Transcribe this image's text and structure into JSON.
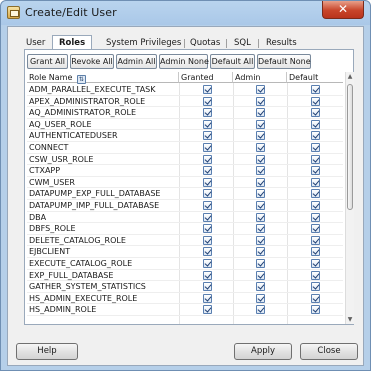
{
  "window": {
    "title": "Create/Edit User",
    "close_glyph": "✕"
  },
  "tabs": [
    {
      "label": "User"
    },
    {
      "label": "Roles",
      "active": true
    },
    {
      "label": "System Privileges"
    },
    {
      "label": "Quotas"
    },
    {
      "label": "SQL"
    },
    {
      "label": "Results"
    }
  ],
  "toolbar": [
    "Grant All",
    "Revoke All",
    "Admin All",
    "Admin None",
    "Default All",
    "Default None"
  ],
  "grid": {
    "columns": [
      "Role Name",
      "Granted",
      "Admin",
      "Default"
    ],
    "sort_icon": "sort-icon",
    "rows": [
      {
        "name": "ADM_PARALLEL_EXECUTE_TASK",
        "granted": true,
        "admin": true,
        "default": true
      },
      {
        "name": "APEX_ADMINISTRATOR_ROLE",
        "granted": true,
        "admin": true,
        "default": true
      },
      {
        "name": "AQ_ADMINISTRATOR_ROLE",
        "granted": true,
        "admin": true,
        "default": true
      },
      {
        "name": "AQ_USER_ROLE",
        "granted": true,
        "admin": true,
        "default": true
      },
      {
        "name": "AUTHENTICATEDUSER",
        "granted": true,
        "admin": true,
        "default": true
      },
      {
        "name": "CONNECT",
        "granted": true,
        "admin": true,
        "default": true
      },
      {
        "name": "CSW_USR_ROLE",
        "granted": true,
        "admin": true,
        "default": true
      },
      {
        "name": "CTXAPP",
        "granted": true,
        "admin": true,
        "default": true
      },
      {
        "name": "CWM_USER",
        "granted": true,
        "admin": true,
        "default": true
      },
      {
        "name": "DATAPUMP_EXP_FULL_DATABASE",
        "granted": true,
        "admin": true,
        "default": true
      },
      {
        "name": "DATAPUMP_IMP_FULL_DATABASE",
        "granted": true,
        "admin": true,
        "default": true
      },
      {
        "name": "DBA",
        "granted": true,
        "admin": true,
        "default": true
      },
      {
        "name": "DBFS_ROLE",
        "granted": true,
        "admin": true,
        "default": true
      },
      {
        "name": "DELETE_CATALOG_ROLE",
        "granted": true,
        "admin": true,
        "default": true
      },
      {
        "name": "EJBCLIENT",
        "granted": true,
        "admin": true,
        "default": true
      },
      {
        "name": "EXECUTE_CATALOG_ROLE",
        "granted": true,
        "admin": true,
        "default": true
      },
      {
        "name": "EXP_FULL_DATABASE",
        "granted": true,
        "admin": true,
        "default": true
      },
      {
        "name": "GATHER_SYSTEM_STATISTICS",
        "granted": true,
        "admin": true,
        "default": true
      },
      {
        "name": "HS_ADMIN_EXECUTE_ROLE",
        "granted": true,
        "admin": true,
        "default": true
      },
      {
        "name": "HS_ADMIN_ROLE",
        "granted": true,
        "admin": true,
        "default": true
      }
    ]
  },
  "scrollbar": {
    "up_glyph": "▲",
    "down_glyph": "▼"
  },
  "buttons": {
    "help": "Help",
    "apply": "Apply",
    "close": "Close"
  },
  "colors": {
    "title_bar": "#aac8e8",
    "close_button": "#c8452a",
    "checkbox_border": "#5a7fb0"
  }
}
